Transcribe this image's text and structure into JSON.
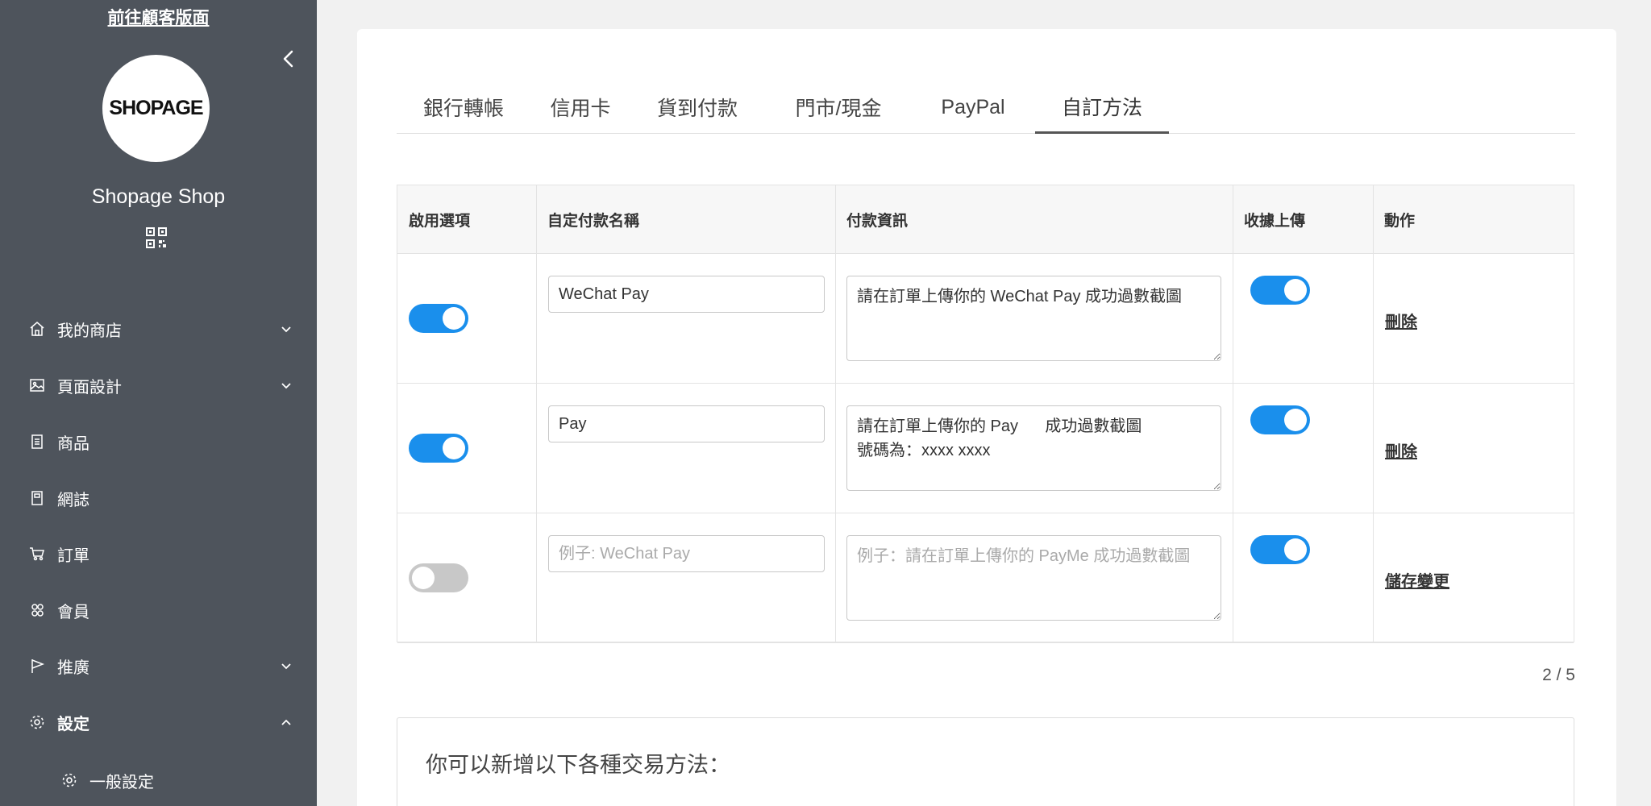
{
  "sidebar": {
    "visit_link": "前往顧客版面",
    "logo_text": "SHOPAGE",
    "shop_name": "Shopage Shop",
    "items": [
      {
        "label": "我的商店",
        "icon": "home-icon",
        "chevron": "down"
      },
      {
        "label": "頁面設計",
        "icon": "image-icon",
        "chevron": "down"
      },
      {
        "label": "商品",
        "icon": "product-list-icon",
        "chevron": ""
      },
      {
        "label": "網誌",
        "icon": "blog-icon",
        "chevron": ""
      },
      {
        "label": "訂單",
        "icon": "cart-icon",
        "chevron": ""
      },
      {
        "label": "會員",
        "icon": "members-icon",
        "chevron": ""
      },
      {
        "label": "推廣",
        "icon": "promote-flag-icon",
        "chevron": "down"
      },
      {
        "label": "設定",
        "icon": "gear-icon",
        "chevron": "up",
        "active": true
      }
    ],
    "sub_items": [
      {
        "label": "一般設定",
        "icon": "gear-icon"
      }
    ]
  },
  "tabs": [
    "銀行轉帳",
    "信用卡",
    "貨到付款",
    "門市/現金",
    "PayPal",
    "自訂方法"
  ],
  "active_tab": "自訂方法",
  "table": {
    "headers": [
      "啟用選項",
      "自定付款名稱",
      "付款資訊",
      "收據上傳",
      "動作"
    ],
    "rows": [
      {
        "enabled": true,
        "name": "WeChat Pay",
        "name_placeholder": "",
        "info": "請在訂單上傳你的 WeChat Pay 成功過數截圖",
        "info_placeholder": "",
        "receipt_upload": true,
        "action": "刪除"
      },
      {
        "enabled": true,
        "name": "Pay",
        "name_placeholder": "",
        "info": "請在訂單上傳你的 Pay      成功過數截圖\n號碼為：xxxx xxxx",
        "info_placeholder": "",
        "receipt_upload": true,
        "action": "刪除"
      },
      {
        "enabled": false,
        "name": "",
        "name_placeholder": "例子: WeChat Pay",
        "info": "",
        "info_placeholder": "例子：請在訂單上傳你的 PayMe 成功過數截圖",
        "receipt_upload": true,
        "action": "儲存變更"
      }
    ]
  },
  "pagination": "2 / 5",
  "add_methods_title": "你可以新增以下各種交易方法：",
  "colors": {
    "sidebar_bg": "#4e545c",
    "toggle_on": "#1a8fec",
    "toggle_off": "#c8c8c8"
  }
}
